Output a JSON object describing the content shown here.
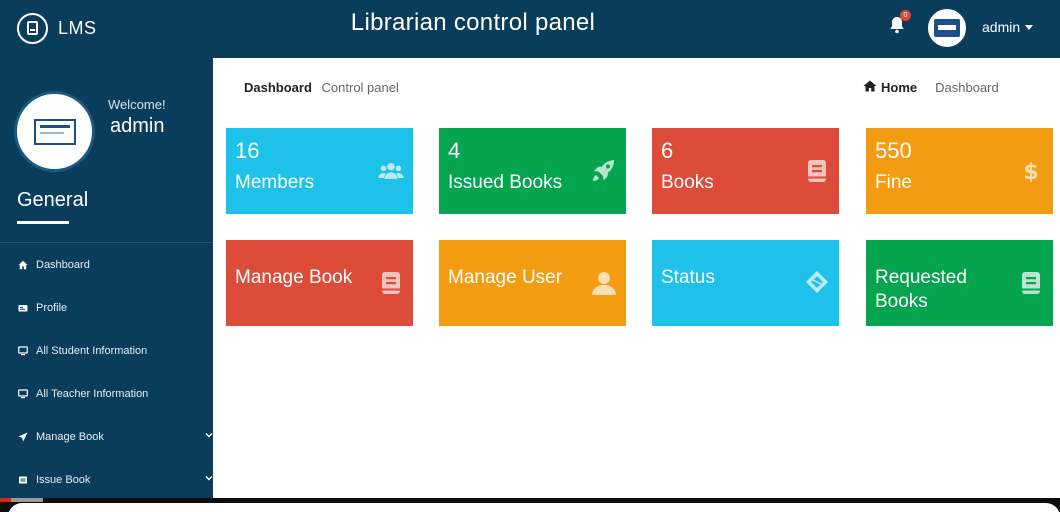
{
  "topbar": {
    "brand": "LMS",
    "title": "Librarian control panel",
    "notification_count": "0",
    "user": "admin"
  },
  "sidebar": {
    "welcome": "Welcome!",
    "name": "admin",
    "section": "General",
    "items": [
      {
        "label": "Dashboard",
        "icon": "home-icon"
      },
      {
        "label": "Profile",
        "icon": "id-card-icon"
      },
      {
        "label": "All Student Information",
        "icon": "monitor-icon"
      },
      {
        "label": "All Teacher Information",
        "icon": "monitor-icon"
      },
      {
        "label": "Manage Book",
        "icon": "send-icon",
        "expandable": true
      },
      {
        "label": "Issue Book",
        "icon": "book-icon",
        "expandable": true
      }
    ]
  },
  "breadcrumb": {
    "title": "Dashboard",
    "subtitle": "Control panel",
    "home": "Home",
    "current": "Dashboard"
  },
  "tiles": {
    "members": {
      "value": "16",
      "label": "Members",
      "color": "#1ec1ea",
      "icon": "users-icon"
    },
    "issued": {
      "value": "4",
      "label": "Issued Books",
      "color": "#05a54f",
      "icon": "rocket-icon"
    },
    "books": {
      "value": "6",
      "label": "Books",
      "color": "#dd4b39",
      "icon": "book-icon"
    },
    "fine": {
      "value": "550",
      "label": "Fine",
      "color": "#f39c12",
      "icon": "dollar-icon"
    },
    "manage_book": {
      "label": "Manage Book",
      "color": "#dd4b39",
      "icon": "book-icon"
    },
    "manage_user": {
      "label": "Manage User",
      "color": "#f39c12",
      "icon": "user-icon"
    },
    "status": {
      "label": "Status",
      "color": "#1ec1ea",
      "icon": "layers-icon"
    },
    "requested": {
      "label": "Requested Books",
      "color": "#05a54f",
      "icon": "book-icon"
    }
  }
}
